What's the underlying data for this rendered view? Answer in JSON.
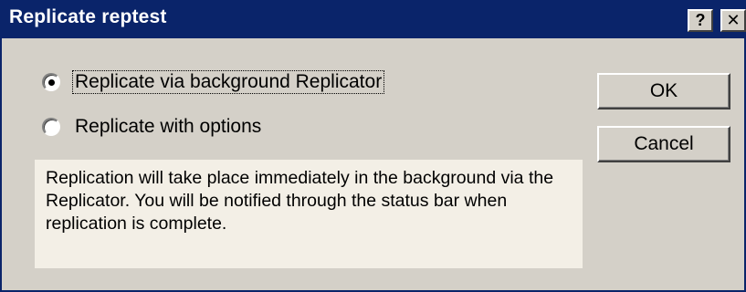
{
  "window": {
    "title": "Replicate reptest",
    "help_glyph": "?",
    "close_glyph": "✕"
  },
  "options": [
    {
      "label": "Replicate via background Replicator",
      "selected": true
    },
    {
      "label": "Replicate with options",
      "selected": false
    }
  ],
  "buttons": {
    "ok_label": "OK",
    "cancel_label": "Cancel"
  },
  "info": {
    "text": "Replication will take place immediately in the background via the Replicator.  You will be notified through the status bar when replication is complete."
  },
  "colors": {
    "title_bar": "#0a246a",
    "dialog_face": "#d4d0c8",
    "info_background": "#f3efe6"
  }
}
